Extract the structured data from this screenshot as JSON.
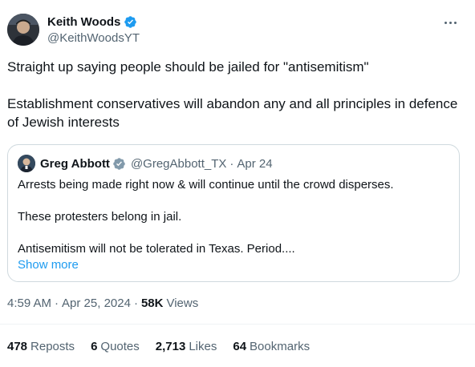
{
  "colors": {
    "text": "#0f1419",
    "secondary": "#536471",
    "link": "#1d9bf0",
    "verified": "#1d9bf0",
    "border": "#cfd9de"
  },
  "tweet": {
    "author": {
      "name": "Keith Woods",
      "handle": "@KeithWoodsYT",
      "avatar_icon": "user-avatar",
      "verified_icon": "verified-badge-icon"
    },
    "more_icon": "more-options-icon",
    "text_paragraphs": [
      "Straight up saying people should be jailed for \"antisemitism\"",
      "Establishment conservatives will abandon any and all principles in defence of Jewish interests"
    ],
    "quoted": {
      "name": "Greg Abbott",
      "handle": "@GregAbbott_TX",
      "separator": "·",
      "date": "Apr 24",
      "verified_icon": "verified-badge-gray-icon",
      "lines": [
        "Arrests being made right now & will continue until the crowd disperses.",
        "These protesters belong in jail.",
        "Antisemitism will not be tolerated in Texas. Period...."
      ],
      "show_more": "Show more"
    },
    "timestamp": {
      "time": "4:59 AM",
      "sep1": "·",
      "date": "Apr 25, 2024",
      "sep2": "·",
      "views_count": "58K",
      "views_label": "Views"
    },
    "stats": [
      {
        "count": "478",
        "label": "Reposts"
      },
      {
        "count": "6",
        "label": "Quotes"
      },
      {
        "count": "2,713",
        "label": "Likes"
      },
      {
        "count": "64",
        "label": "Bookmarks"
      }
    ]
  }
}
